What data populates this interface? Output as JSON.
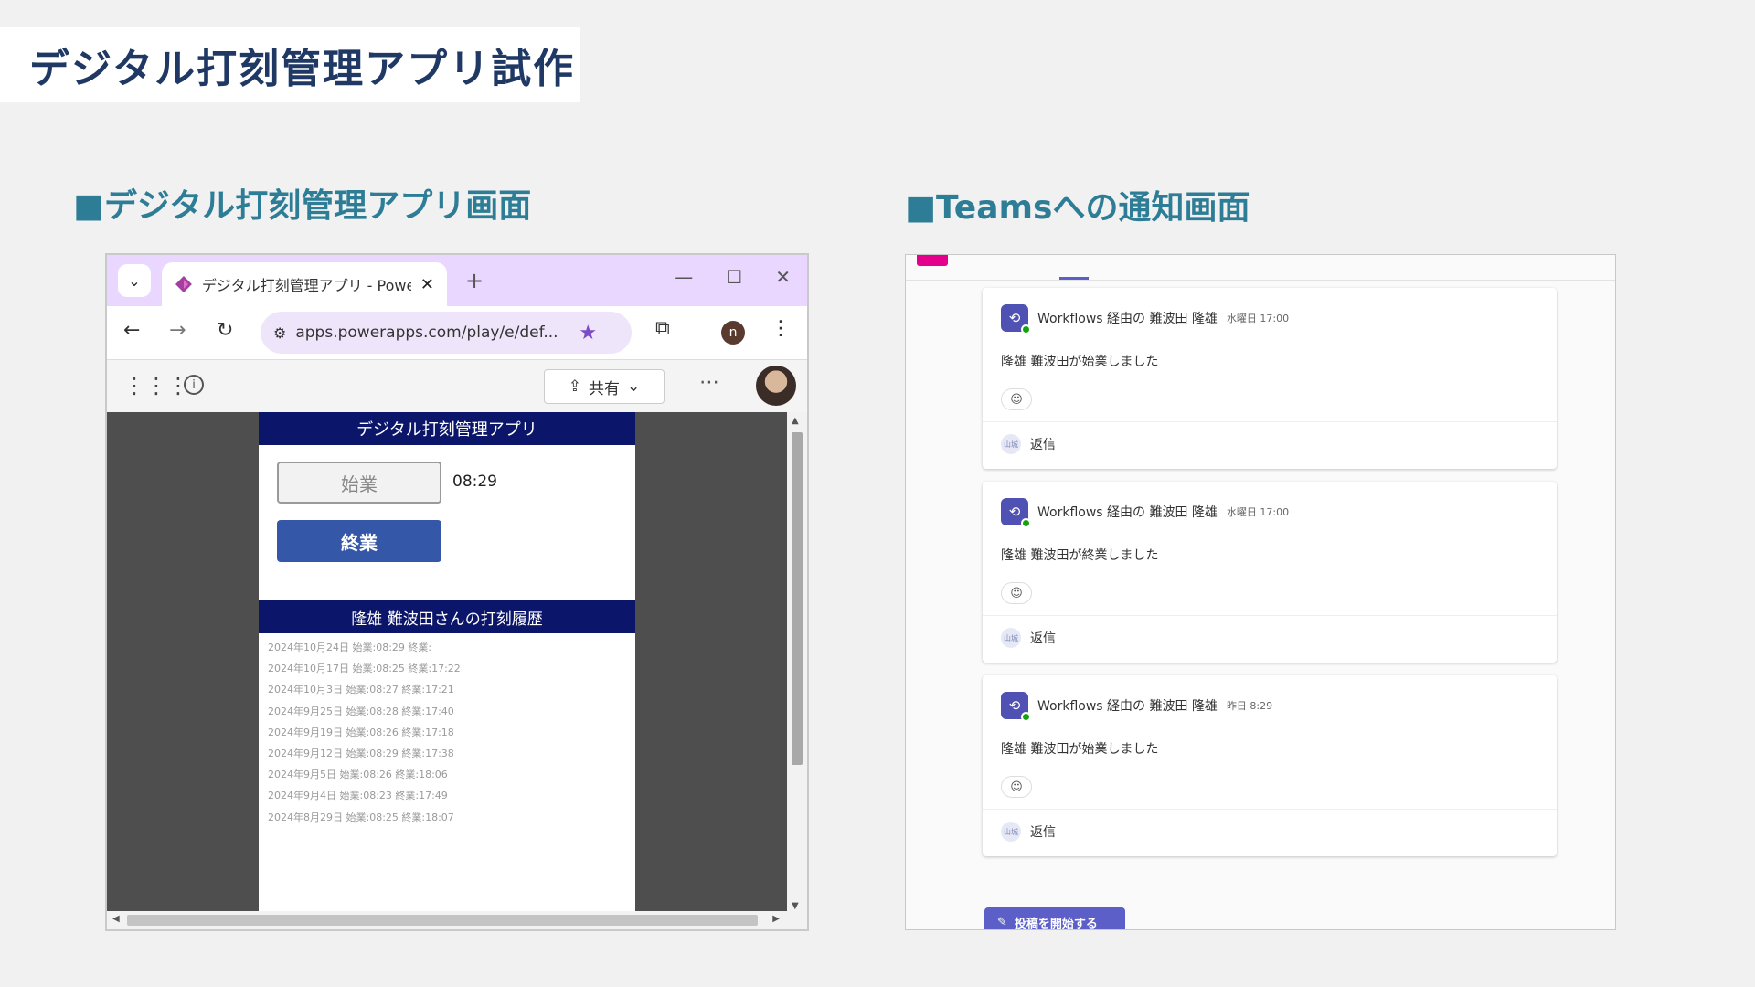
{
  "slide": {
    "title": "デジタル打刻管理アプリ試作",
    "section_left": "■デジタル打刻管理アプリ画面",
    "section_right": "■Teamsへの通知画面"
  },
  "browser": {
    "tab_title": "デジタル打刻管理アプリ - Power A",
    "tab_close": "✕",
    "new_tab": "+",
    "url": "apps.powerapps.com/play/e/def...",
    "profile_initial": "n",
    "share_label": "共有",
    "more_label": "⋯"
  },
  "app": {
    "header": "デジタル打刻管理アプリ",
    "start_button": "始業",
    "start_time": "08:29",
    "end_button": "終業",
    "history_header": "隆雄 難波田さんの打刻履歴",
    "history": [
      "2024年10月24日 始業:08:29 終業:",
      "2024年10月17日 始業:08:25 終業:17:22",
      "2024年10月3日 始業:08:27 終業:17:21",
      "2024年9月25日 始業:08:28 終業:17:40",
      "2024年9月19日 始業:08:26 終業:17:18",
      "2024年9月12日 始業:08:29 終業:17:38",
      "2024年9月5日 始業:08:26 終業:18:06",
      "2024年9月4日 始業:08:23 終業:17:49",
      "2024年8月29日 始業:08:25 終業:18:07"
    ]
  },
  "teams": {
    "messages": [
      {
        "sender": "Workflows 経由の 難波田 隆雄",
        "time": "水曜日 17:00",
        "body": "隆雄 難波田が始業しました",
        "reply_label": "返信",
        "reply_avatar": "山城"
      },
      {
        "sender": "Workflows 経由の 難波田 隆雄",
        "time": "水曜日 17:00",
        "body": "隆雄 難波田が終業しました",
        "reply_label": "返信",
        "reply_avatar": "山城"
      },
      {
        "sender": "Workflows 経由の 難波田 隆雄",
        "time": "昨日 8:29",
        "body": "隆雄 難波田が始業しました",
        "reply_label": "返信",
        "reply_avatar": "山城"
      }
    ],
    "post_button": "投稿を開始する"
  },
  "colors": {
    "title_text": "#1f3864",
    "section_text": "#2e7d96",
    "app_header": "#0b1569",
    "end_button": "#3457a8",
    "teams_accent": "#5b5fc7",
    "browser_tabbar": "#e9d7ff"
  }
}
